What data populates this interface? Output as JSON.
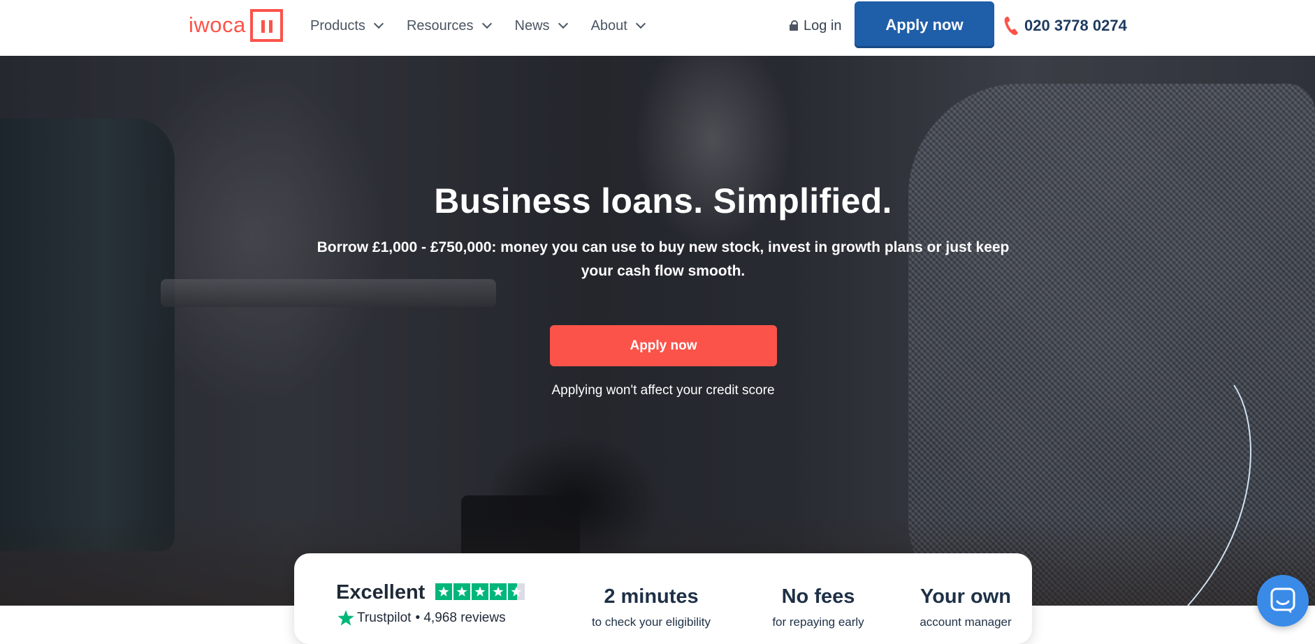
{
  "brand": {
    "name": "iwoca",
    "color": "#fb534a"
  },
  "nav": {
    "items": [
      {
        "label": "Products"
      },
      {
        "label": "Resources"
      },
      {
        "label": "News"
      },
      {
        "label": "About"
      }
    ],
    "login_label": "Log in",
    "apply_label": "Apply now",
    "phone": "020 3778 0274"
  },
  "hero": {
    "title": "Business loans. Simplified.",
    "subtitle": "Borrow £1,000 - £750,000: money you can use to buy new stock, invest in growth plans or just keep your cash flow smooth.",
    "cta_label": "Apply now",
    "note": "Applying won't affect your credit score"
  },
  "stats": {
    "trustpilot": {
      "rating_word": "Excellent",
      "stars": 4.5,
      "brand": "Trustpilot",
      "reviews": "• 4,968 reviews"
    },
    "items": [
      {
        "title": "2 minutes",
        "sub": "to check your eligibility"
      },
      {
        "title": "No fees",
        "sub": "for repaying early"
      },
      {
        "title": "Your own",
        "sub": "account manager"
      }
    ]
  },
  "colors": {
    "primary_blue": "#1f5ea8",
    "accent_red": "#fb534a",
    "trustpilot_green": "#00b67a",
    "chat_blue": "#3a8be8"
  },
  "icons": [
    "chevron-down-icon",
    "lock-icon",
    "phone-icon",
    "trustpilot-star-icon",
    "chat-icon"
  ]
}
